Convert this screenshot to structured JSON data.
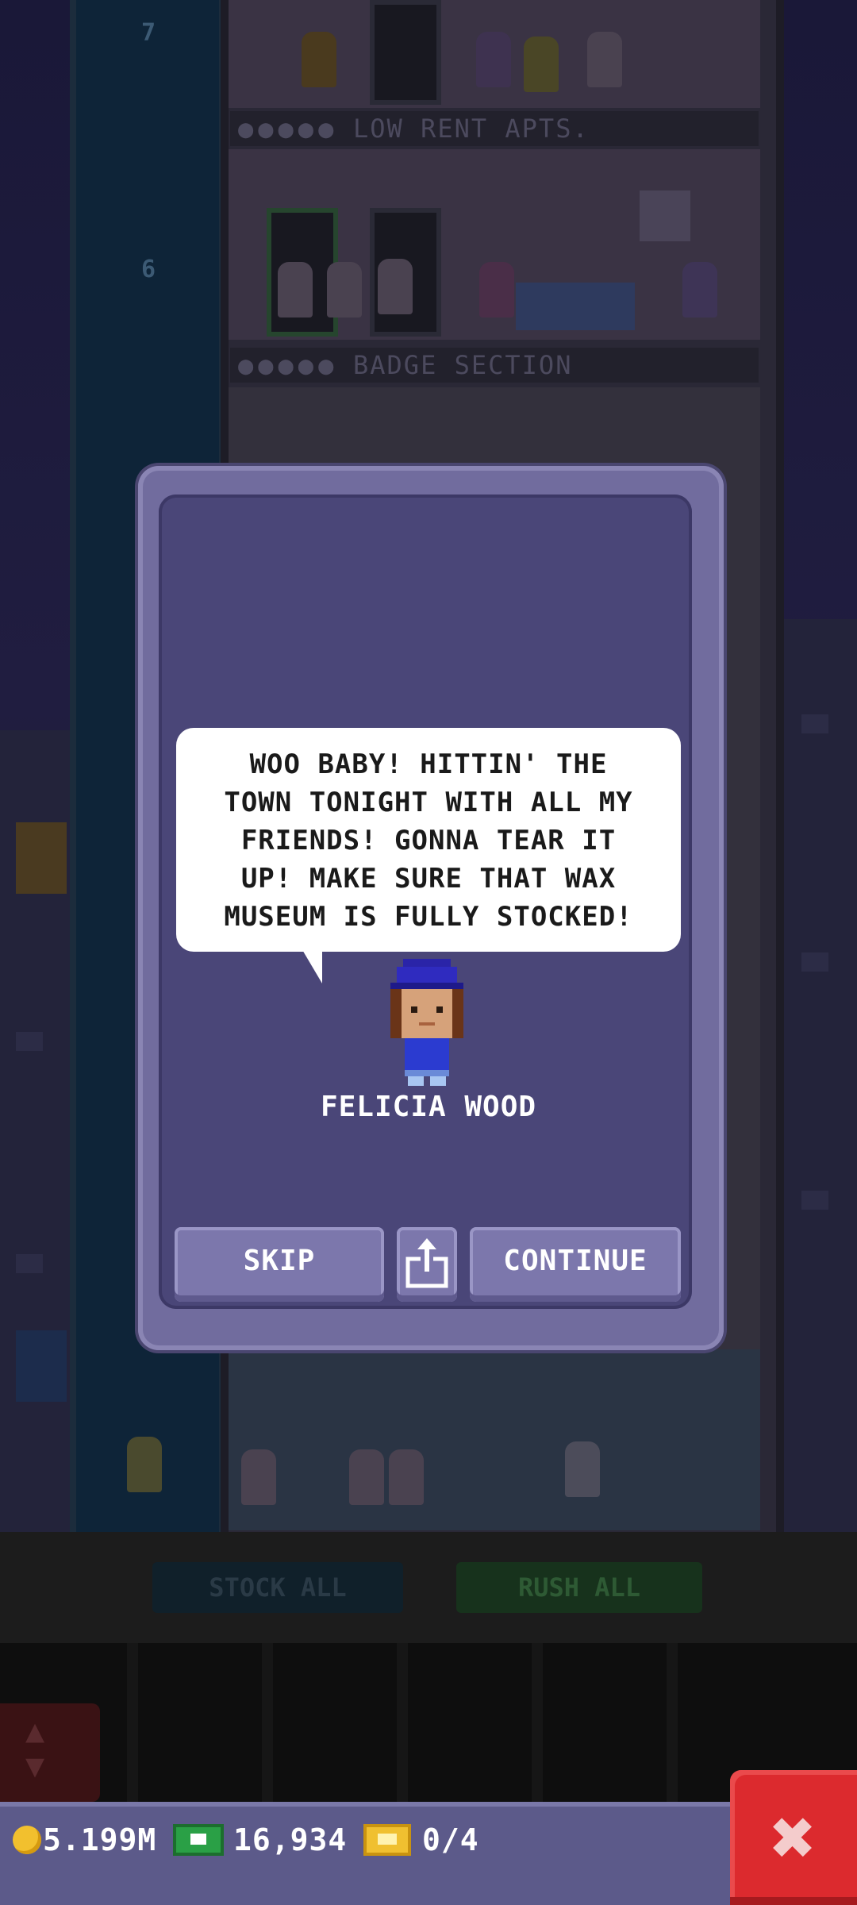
{
  "scene": {
    "floors": [
      {
        "number": "7",
        "label": "LOW RENT APTS."
      },
      {
        "number": "6",
        "label": "BADGE SECTION"
      }
    ],
    "actions": {
      "stock_all": "STOCK ALL",
      "rush_all": "RUSH ALL"
    }
  },
  "dialog": {
    "message": "WOO BABY! HITTIN' THE\nTOWN TONIGHT WITH ALL MY\nFRIENDS! GONNA TEAR IT\nUP! MAKE SURE THAT WAX\nMUSEUM IS FULLY STOCKED!",
    "speaker": "FELICIA WOOD",
    "buttons": {
      "skip": "SKIP",
      "continue": "CONTINUE",
      "share_icon": "share-icon"
    }
  },
  "status": {
    "coins": "5.199M",
    "bux": "16,934",
    "tickets": "0/4"
  },
  "colors": {
    "dialog_frame": "#716c9e",
    "dialog_inner": "#4a4678",
    "button": "#7c77ac",
    "close_button": "#dc2a2e",
    "status_bar": "#5c5a8a"
  }
}
